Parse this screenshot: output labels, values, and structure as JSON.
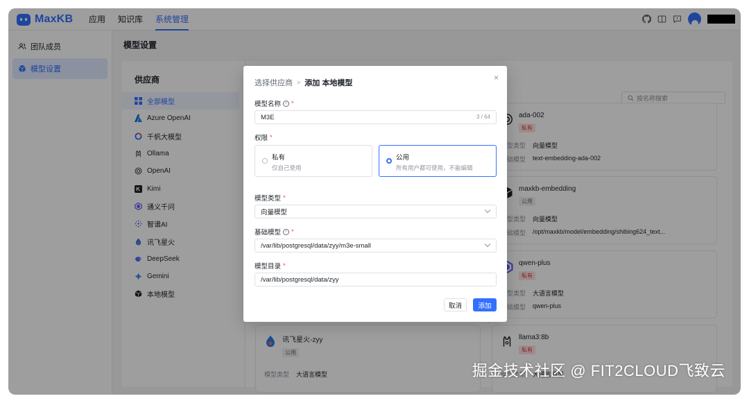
{
  "app": {
    "name": "MaxKB"
  },
  "nav": {
    "items": [
      {
        "label": "应用",
        "active": false
      },
      {
        "label": "知识库",
        "active": false
      },
      {
        "label": "系统管理",
        "active": true
      }
    ]
  },
  "sidebar": {
    "items": [
      {
        "label": "团队成员",
        "icon": "team-icon",
        "active": false
      },
      {
        "label": "模型设置",
        "icon": "cube-icon",
        "active": true
      }
    ]
  },
  "page": {
    "title": "模型设置"
  },
  "providers": {
    "title": "供应商",
    "items": [
      {
        "label": "全部模型",
        "icon": "grid-icon",
        "active": true
      },
      {
        "label": "Azure OpenAI",
        "icon": "azure-icon",
        "active": false
      },
      {
        "label": "千帆大模型",
        "icon": "qianfan-icon",
        "active": false
      },
      {
        "label": "Ollama",
        "icon": "ollama-icon",
        "active": false
      },
      {
        "label": "OpenAI",
        "icon": "openai-icon",
        "active": false
      },
      {
        "label": "Kimi",
        "icon": "kimi-icon",
        "active": false
      },
      {
        "label": "通义千问",
        "icon": "tongyi-icon",
        "active": false
      },
      {
        "label": "智谱AI",
        "icon": "zhipu-icon",
        "active": false
      },
      {
        "label": "讯飞星火",
        "icon": "xunfei-icon",
        "active": false
      },
      {
        "label": "DeepSeek",
        "icon": "deepseek-icon",
        "active": false
      },
      {
        "label": "Gemini",
        "icon": "gemini-icon",
        "active": false
      },
      {
        "label": "本地模型",
        "icon": "local-model-icon",
        "active": false
      }
    ]
  },
  "search": {
    "placeholder": "按名称搜索"
  },
  "cards": [
    {
      "name": "ada-002",
      "tag": "私有",
      "tag_kind": "private",
      "icon": "openai-icon",
      "rows": [
        {
          "k": "模型类型",
          "v": "向量模型"
        },
        {
          "k": "基础模型",
          "v": "text-embedding-ada-002"
        }
      ]
    },
    {
      "name": "maxkb-embedding",
      "tag": "公用",
      "tag_kind": "public",
      "icon": "local-model-icon",
      "rows": [
        {
          "k": "模型类型",
          "v": "向量模型"
        },
        {
          "k": "基础模型",
          "v": "/opt/maxkb/model/embedding/shibing624_text..."
        }
      ]
    },
    {
      "name": "qwen-plus",
      "tag": "私有",
      "tag_kind": "private",
      "icon": "tongyi-icon",
      "rows": [
        {
          "k": "模型类型",
          "v": "大语言模型"
        },
        {
          "k": "基础模型",
          "v": "qwen-plus"
        }
      ]
    },
    {
      "name": "讯飞星火-zyy",
      "tag": "公用",
      "tag_kind": "public",
      "icon": "xunfei-icon",
      "rows": [
        {
          "k": "模型类型",
          "v": "大语言模型"
        }
      ]
    },
    {
      "name": "llama3:8b",
      "tag": "私有",
      "tag_kind": "private",
      "icon": "ollama-icon",
      "rows": [
        {
          "k": "模型类型",
          "v": "大语言模型"
        }
      ]
    }
  ],
  "dialog": {
    "breadcrumb_prev": "选择供应商",
    "breadcrumb_sep": ">",
    "breadcrumb_current": "添加 本地模型",
    "close": "×",
    "model_name": {
      "label": "模型名称",
      "value": "M3E",
      "counter": "3 / 64"
    },
    "permission": {
      "label": "权限",
      "options": [
        {
          "title": "私有",
          "desc": "仅自己使用",
          "selected": false
        },
        {
          "title": "公用",
          "desc": "所有用户都可使用，不能编辑",
          "selected": true
        }
      ]
    },
    "model_type": {
      "label": "模型类型",
      "value": "向量模型"
    },
    "base_model": {
      "label": "基础模型",
      "value": "/var/lib/postgresql/data/zyy/m3e-small"
    },
    "model_dir": {
      "label": "模型目录",
      "value": "/var/lib/postgresql/data/zyy"
    },
    "cancel_label": "取消",
    "add_label": "添加"
  },
  "watermark": "掘金技术社区 @ FIT2CLOUD飞致云",
  "colors": {
    "accent": "#3370ff",
    "danger": "#f54a45",
    "private_tag_bg": "#fde2e2"
  }
}
